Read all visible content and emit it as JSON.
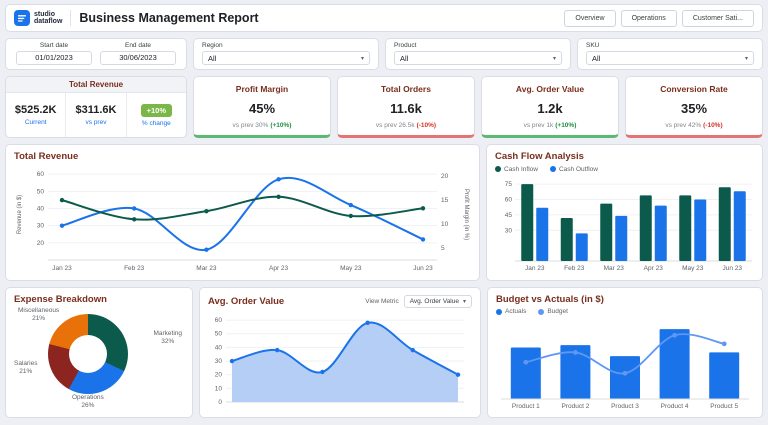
{
  "theme": {
    "accent_blue": "#1a73e8",
    "dark_green": "#0c5a4c",
    "maroon": "#7a2e1d",
    "positive_green": "#1e8e3e",
    "negative_red": "#d93025",
    "badge_green": "#7ab648",
    "trend_up_bar": "#5bb974",
    "trend_down_bar": "#e57373"
  },
  "icons": {
    "chevron_down": "▾"
  },
  "header": {
    "logo_line1": "studio",
    "logo_line2": "dataflow",
    "title": "Business Management Report",
    "nav_tabs": [
      {
        "label": "Overview"
      },
      {
        "label": "Operations"
      },
      {
        "label": "Customer Sati..."
      }
    ]
  },
  "filters": {
    "start_date_label": "Start date",
    "start_date_value": "01/01/2023",
    "end_date_label": "End date",
    "end_date_value": "30/06/2023",
    "region_label": "Region",
    "region_value": "All",
    "product_label": "Product",
    "product_value": "All",
    "sku_label": "SKU",
    "sku_value": "All"
  },
  "kpis": {
    "total_revenue": {
      "title": "Total Revenue",
      "current_value": "$525.2K",
      "current_label": "Current",
      "prev_value": "$311.6K",
      "prev_label": "vs prev",
      "change_value": "+10%",
      "change_label": "% change"
    },
    "cards": [
      {
        "title": "Profit Margin",
        "value": "45%",
        "prev_text": "vs prev 30%",
        "change_text": "(+10%)",
        "trend": "up"
      },
      {
        "title": "Total Orders",
        "value": "11.6k",
        "prev_text": "vs prev 26.5k",
        "change_text": "(-10%)",
        "trend": "down"
      },
      {
        "title": "Avg. Order Value",
        "value": "1.2k",
        "prev_text": "vs prev 1k",
        "change_text": "(+10%)",
        "trend": "up"
      },
      {
        "title": "Conversion Rate",
        "value": "35%",
        "prev_text": "vs prev 42%",
        "change_text": "(-10%)",
        "trend": "down"
      }
    ]
  },
  "chart_data": [
    {
      "id": "total_revenue",
      "type": "line",
      "title": "Total Revenue",
      "x": [
        "Jan 23",
        "Feb 23",
        "Mar 23",
        "Apr 23",
        "May 23",
        "Jun 23"
      ],
      "ylabel_left": "Revenue (in $)",
      "ylabel_right": "Profit Margin (in %)",
      "yticks_left": [
        20,
        30,
        40,
        50,
        60
      ],
      "ylim_left": [
        10,
        63
      ],
      "yticks_right": [
        5,
        10,
        15,
        20
      ],
      "ylim_right": [
        2.5,
        21.5
      ],
      "series": [
        {
          "name": "Revenue",
          "axis": "left",
          "color": "#1a73e8",
          "values": [
            30,
            40,
            16,
            57,
            42,
            22
          ]
        },
        {
          "name": "Profit Margin",
          "axis": "right",
          "color": "#0c5a4c",
          "values": [
            15,
            11,
            12.7,
            15.7,
            11.7,
            13.3
          ]
        }
      ],
      "grid": true,
      "legend": "none"
    },
    {
      "id": "cash_flow",
      "type": "bar",
      "title": "Cash Flow Analysis",
      "categories": [
        "Jan 23",
        "Feb 23",
        "Mar 23",
        "Apr 23",
        "May 23",
        "Jun 23"
      ],
      "yticks": [
        30,
        45,
        60,
        75
      ],
      "ylim": [
        0,
        80
      ],
      "legend_position": "top",
      "series": [
        {
          "name": "Cash Inflow",
          "color": "#0c5a4c",
          "values": [
            75,
            42,
            56,
            64,
            64,
            72
          ]
        },
        {
          "name": "Cash Outflow",
          "color": "#1a73e8",
          "values": [
            52,
            27,
            44,
            54,
            60,
            68
          ]
        }
      ]
    },
    {
      "id": "expense_breakdown",
      "type": "pie",
      "title": "Expense Breakdown",
      "slices": [
        {
          "label": "Marketing",
          "pct": 32,
          "pct_text": "32%",
          "color": "#0c5a4c"
        },
        {
          "label": "Operations",
          "pct": 26,
          "pct_text": "26%",
          "color": "#1a73e8"
        },
        {
          "label": "Salaries",
          "pct": 21,
          "pct_text": "21%",
          "color": "#8c2420"
        },
        {
          "label": "Miscellaneous",
          "pct": 21,
          "pct_text": "21%",
          "color": "#e8710a"
        }
      ]
    },
    {
      "id": "avg_order_value",
      "type": "area",
      "title": "Avg. Order Value",
      "toolbar": {
        "view_metric_label": "View Metric",
        "metric_value": "Avg. Order Value"
      },
      "yticks": [
        0,
        10,
        20,
        30,
        40,
        50,
        60
      ],
      "ylim": [
        0,
        63
      ],
      "color": "#1a73e8",
      "fill": "#adc9f4",
      "values": [
        30,
        38,
        22,
        58,
        38,
        20
      ]
    },
    {
      "id": "budget_vs_actuals",
      "type": "bar-line",
      "title": "Budget vs Actuals (in $)",
      "categories": [
        "Product 1",
        "Product 2",
        "Product 3",
        "Product 4",
        "Product 5"
      ],
      "ylim": [
        0,
        62
      ],
      "legend_position": "top",
      "bars": {
        "name": "Actuals",
        "color": "#1a73e8",
        "values": [
          42,
          44,
          35,
          57,
          38
        ]
      },
      "line": {
        "name": "Budget",
        "color": "#5e97f6",
        "values": [
          30,
          38,
          21,
          52,
          45
        ]
      }
    }
  ]
}
